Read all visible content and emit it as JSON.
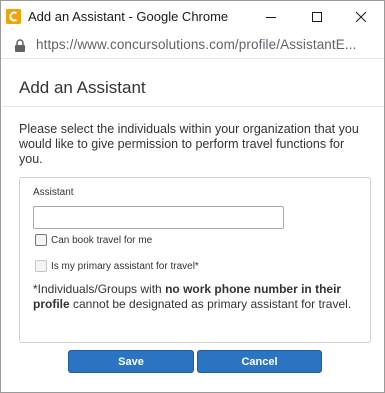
{
  "window": {
    "title": "Add an Assistant - Google Chrome",
    "controls": {
      "minimize": "minimize",
      "maximize": "maximize",
      "close": "close"
    }
  },
  "address_bar": {
    "url": "https://www.concursolutions.com/profile/AssistantE..."
  },
  "dialog": {
    "title": "Add an Assistant",
    "instructions": "Please select the individuals within your organization that you would like to give permission to perform travel functions for you.",
    "assistant_field": {
      "label": "Assistant",
      "value": "",
      "placeholder": ""
    },
    "options": [
      {
        "label": "Can book travel for me",
        "checked": false,
        "enabled": true
      },
      {
        "label": "Is my primary assistant for travel*",
        "checked": false,
        "enabled": false
      }
    ],
    "note": {
      "prefix": "*Individuals/Groups with ",
      "emphasis": "no work phone number in their profile",
      "suffix": " cannot be designated as primary assistant for travel."
    },
    "buttons": {
      "save": "Save",
      "cancel": "Cancel"
    }
  },
  "colors": {
    "button_bg": "#2b74c2",
    "app_icon": "#f0a30a"
  },
  "icons": [
    "concur-app-icon",
    "minimize-icon",
    "maximize-icon",
    "close-icon",
    "lock-icon"
  ]
}
